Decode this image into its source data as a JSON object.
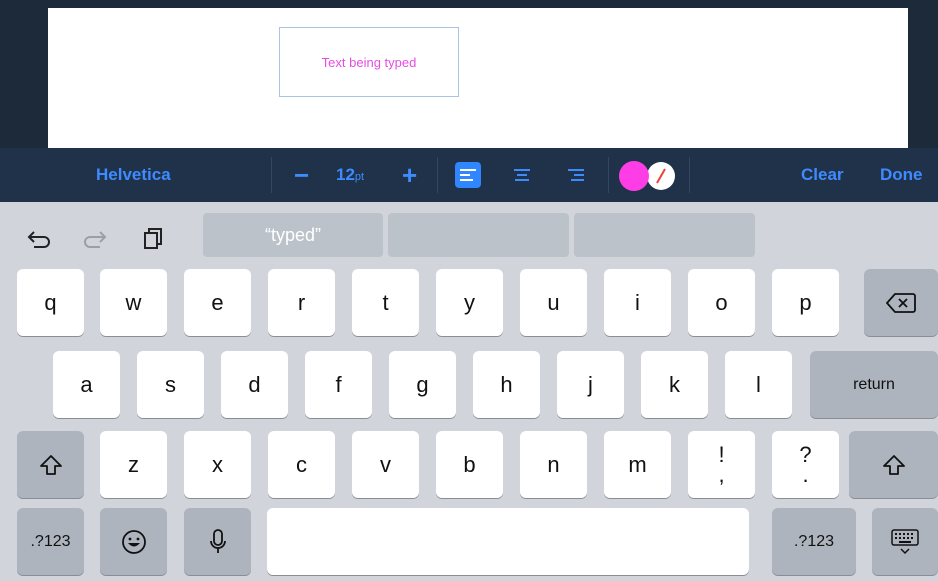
{
  "document": {
    "textbox_text": "Text being typed",
    "text_color": "#e64de3"
  },
  "format_bar": {
    "font_name": "Helvetica",
    "decrease_label": "−",
    "size_value": "12",
    "size_unit": "pt",
    "increase_label": "+",
    "alignments": [
      "align-left",
      "align-center",
      "align-right"
    ],
    "active_alignment": "align-left",
    "fill_color": "#ff3de6",
    "clear_label": "Clear",
    "done_label": "Done",
    "accent_color": "#3d8bff"
  },
  "keyboard": {
    "suggestions": [
      "“typed”",
      "",
      ""
    ],
    "row1": [
      "q",
      "w",
      "e",
      "r",
      "t",
      "y",
      "u",
      "i",
      "o",
      "p"
    ],
    "row2": [
      "a",
      "s",
      "d",
      "f",
      "g",
      "h",
      "j",
      "k",
      "l"
    ],
    "return_label": "return",
    "row3": [
      "z",
      "x",
      "c",
      "v",
      "b",
      "n",
      "m"
    ],
    "punct1_top": "!",
    "punct1_bottom": ",",
    "punct2_top": "?",
    "punct2_bottom": ".",
    "numbers_label": ".?123"
  }
}
